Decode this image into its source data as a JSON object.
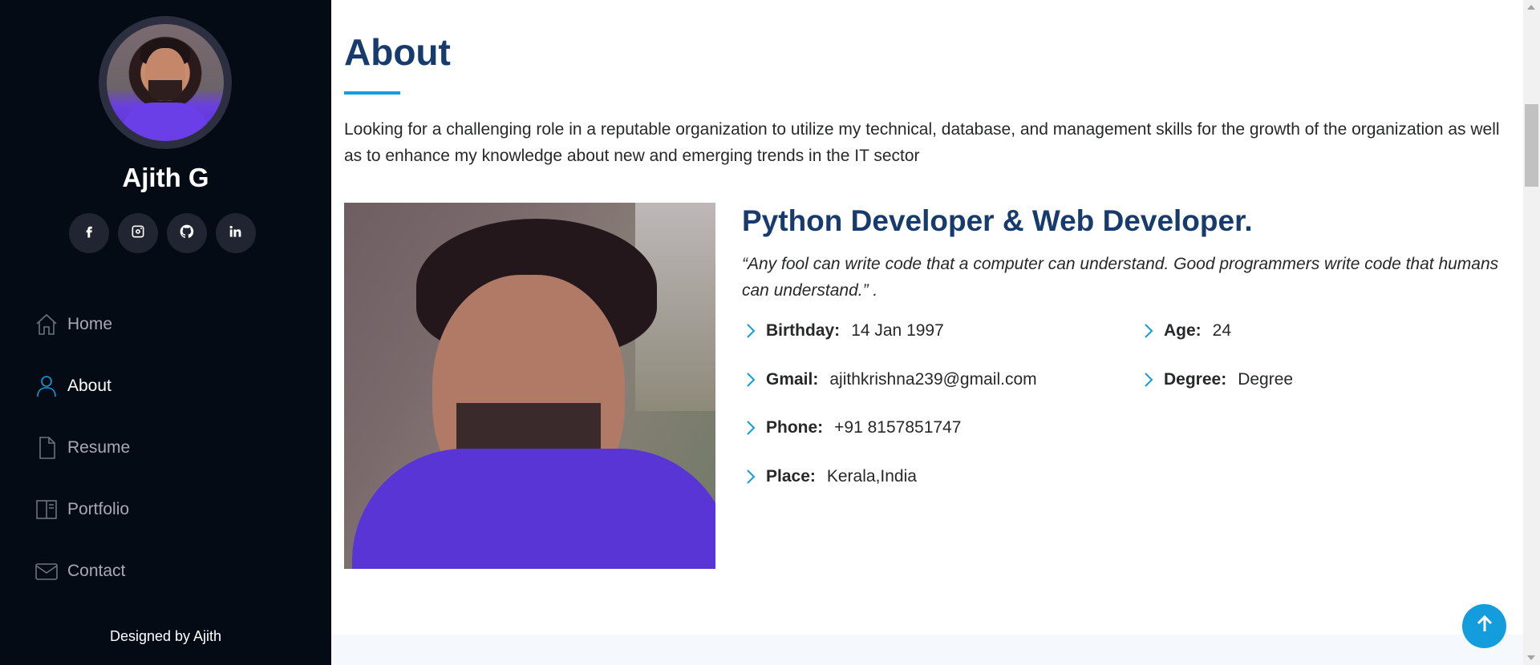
{
  "sidebar": {
    "profile_name": "Ajith G",
    "social": [
      {
        "icon": "facebook-icon"
      },
      {
        "icon": "instagram-icon"
      },
      {
        "icon": "github-icon"
      },
      {
        "icon": "linkedin-icon"
      }
    ],
    "nav": [
      {
        "label": "Home",
        "icon": "home-icon",
        "active": false
      },
      {
        "label": "About",
        "icon": "user-icon",
        "active": true
      },
      {
        "label": "Resume",
        "icon": "file-icon",
        "active": false
      },
      {
        "label": "Portfolio",
        "icon": "book-icon",
        "active": false
      },
      {
        "label": "Contact",
        "icon": "envelope-icon",
        "active": false
      }
    ],
    "footer": "Designed by Ajith"
  },
  "about": {
    "title": "About",
    "intro": "Looking for a challenging role in a reputable organization to utilize my technical, database, and management skills for the growth of the organization as well as to enhance my knowledge about new and emerging trends in the IT sector",
    "role": "Python Developer & Web Developer.",
    "quote": "“Any fool can write code that a computer can understand. Good programmers write code that humans can understand.” .",
    "facts_left": [
      {
        "label": "Birthday:",
        "value": "14 Jan 1997"
      },
      {
        "label": "Gmail:",
        "value": "ajithkrishna239@gmail.com"
      },
      {
        "label": "Phone:",
        "value": "+91 8157851747"
      },
      {
        "label": "Place:",
        "value": "Kerala,India"
      }
    ],
    "facts_right": [
      {
        "label": "Age:",
        "value": "24"
      },
      {
        "label": "Degree:",
        "value": "Degree"
      }
    ]
  },
  "colors": {
    "sidebar_bg": "#040b14",
    "accent": "#149ddd",
    "heading": "#173b6c"
  }
}
